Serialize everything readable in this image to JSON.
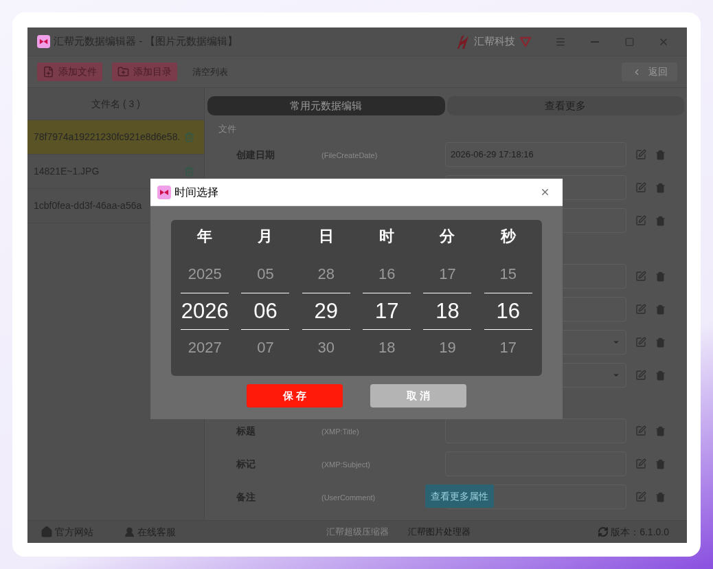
{
  "window": {
    "title": "汇帮元数据编辑器 - 【图片元数据编辑】",
    "brand": "汇帮科技"
  },
  "toolbar": {
    "buttons": [
      {
        "label": "添加文件",
        "kind": "file"
      },
      {
        "label": "添加目录",
        "kind": "folder"
      }
    ],
    "clear": "清空列表",
    "back": "返回"
  },
  "file_list": {
    "header": "文件名 ( 3 )",
    "items": [
      {
        "name": "78f7974a19221230fc921e8d6e58.",
        "selected": true
      },
      {
        "name": "14821E~1.JPG",
        "selected": false
      },
      {
        "name": "1cbf0fea-dd3f-46aa-a56a",
        "selected": false
      }
    ]
  },
  "tabs": [
    {
      "label": "常用元数据编辑",
      "selected": true
    },
    {
      "label": "查看更多",
      "selected": false
    }
  ],
  "sections": [
    {
      "title": "文件",
      "fields": [
        {
          "label": "创建日期",
          "tag": "(FileCreateDate)",
          "value": "2026-06-29 17:18:16",
          "kind": "text"
        },
        {
          "kind": "text"
        },
        {
          "kind": "text"
        }
      ]
    },
    {
      "fields": [
        {
          "kind": "text"
        },
        {
          "kind": "text"
        },
        {
          "kind": "select"
        },
        {
          "kind": "select"
        }
      ]
    },
    {
      "fields": [
        {
          "label": "标题",
          "tag": "(XMP:Title)",
          "kind": "text"
        },
        {
          "label": "标记",
          "tag": "(XMP:Subject)",
          "kind": "text"
        },
        {
          "label": "备注",
          "tag": "(UserComment)",
          "kind": "text"
        }
      ]
    }
  ],
  "more_button": "查看更多属性",
  "status_bar": {
    "links": [
      {
        "label": "官方网站",
        "kind": "home"
      },
      {
        "label": "在线客服",
        "kind": "support"
      }
    ],
    "products": [
      {
        "label": "汇帮超级压缩器",
        "emphasized": false
      },
      {
        "label": "汇帮图片处理器",
        "emphasized": true
      }
    ],
    "version": "版本：6.1.0.0"
  },
  "dialog": {
    "title": "时间选择",
    "columns": [
      {
        "heading": "年",
        "prev": "2025",
        "current": "2026",
        "next": "2027"
      },
      {
        "heading": "月",
        "prev": "05",
        "current": "06",
        "next": "07"
      },
      {
        "heading": "日",
        "prev": "28",
        "current": "29",
        "next": "30"
      },
      {
        "heading": "时",
        "prev": "16",
        "current": "17",
        "next": "18"
      },
      {
        "heading": "分",
        "prev": "17",
        "current": "18",
        "next": "19"
      },
      {
        "heading": "秒",
        "prev": "15",
        "current": "16",
        "next": "17"
      }
    ],
    "save": "保 存",
    "cancel": "取 消"
  }
}
